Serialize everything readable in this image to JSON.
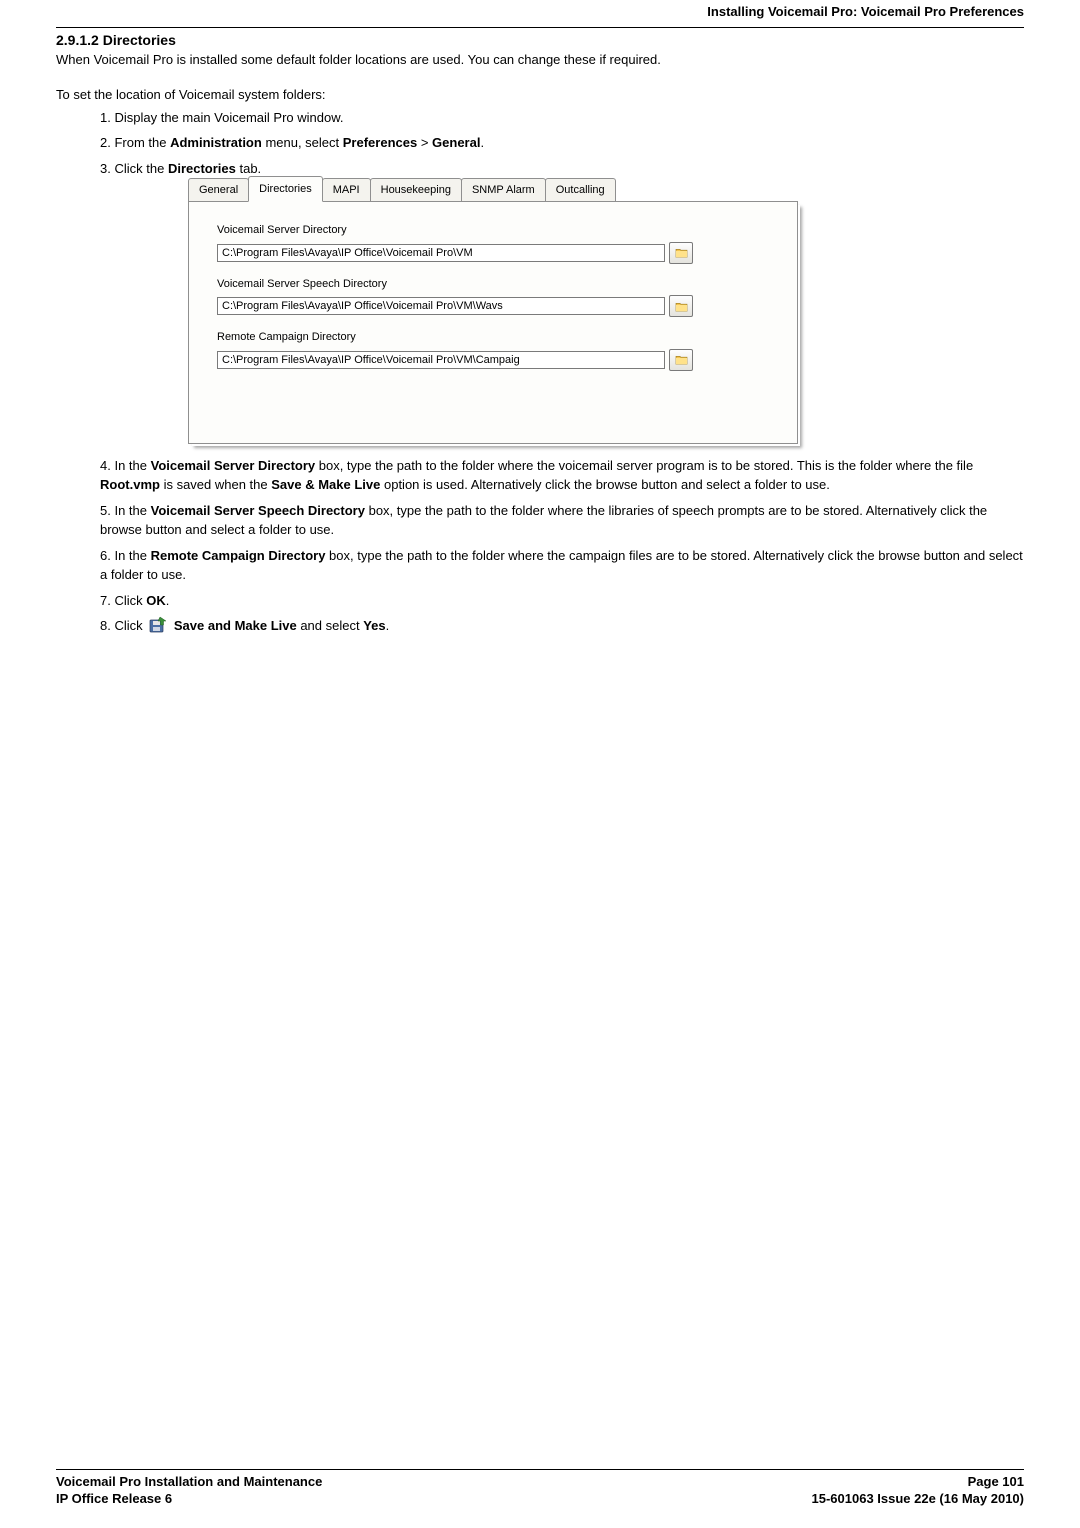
{
  "header": {
    "breadcrumb": "Installing Voicemail Pro: Voicemail Pro Preferences"
  },
  "section": {
    "number": "2.9.1.2",
    "title": "Directories",
    "intro": "When Voicemail Pro is installed some default folder locations are used. You can change these if required.",
    "subhead": "To set the location of Voicemail system folders:"
  },
  "steps": {
    "s1": {
      "num": "1.",
      "text": "Display the main Voicemail Pro window."
    },
    "s2": {
      "num": "2.",
      "pre": "From the ",
      "admin": "Administration",
      "mid": " menu, select ",
      "pref": "Preferences",
      "gt": " > ",
      "gen": "General",
      "post": "."
    },
    "s3": {
      "num": "3.",
      "pre": "Click the ",
      "tab": "Directories",
      "post": " tab."
    },
    "s4": {
      "num": "4.",
      "pre": "In the ",
      "boxname": "Voicemail Server Directory",
      "mid1": " box, type the path to the folder where the voicemail server program is to be stored. This is the folder where the file ",
      "file": "Root.vmp",
      "mid2": " is saved when the ",
      "save": "Save & Make Live",
      "post": " option is used. Alternatively click the browse button and select a folder to use."
    },
    "s5": {
      "num": "5.",
      "pre": "In the ",
      "boxname": "Voicemail Server Speech Directory",
      "post": " box, type the path to the folder where the libraries of speech prompts are to be stored. Alternatively click the browse button and select a folder to use."
    },
    "s6": {
      "num": "6.",
      "pre": "In the ",
      "boxname": "Remote Campaign Directory",
      "post": " box, type the path to the folder where the campaign files are to be stored. Alternatively click the browse button and select a folder to use."
    },
    "s7": {
      "num": "7.",
      "pre": "Click ",
      "ok": "OK",
      "post": "."
    },
    "s8": {
      "num": "8.",
      "pre": "Click ",
      "save": "Save and Make Live",
      "mid": " and select ",
      "yes": "Yes",
      "post": "."
    }
  },
  "dialog": {
    "tabs": {
      "general": "General",
      "directories": "Directories",
      "mapi": "MAPI",
      "housekeeping": "Housekeeping",
      "snmp": "SNMP Alarm",
      "outcalling": "Outcalling"
    },
    "fields": {
      "vsd": {
        "label": "Voicemail Server Directory",
        "value": "C:\\Program Files\\Avaya\\IP Office\\Voicemail Pro\\VM"
      },
      "vssd": {
        "label": "Voicemail Server Speech Directory",
        "value": "C:\\Program Files\\Avaya\\IP Office\\Voicemail Pro\\VM\\Wavs"
      },
      "rcd": {
        "label": "Remote Campaign Directory",
        "value": "C:\\Program Files\\Avaya\\IP Office\\Voicemail Pro\\VM\\Campaig"
      }
    }
  },
  "footer": {
    "left1": "Voicemail Pro Installation and Maintenance",
    "left2": "IP Office Release 6",
    "right1": "Page 101",
    "right2": "15-601063 Issue 22e (16 May 2010)"
  }
}
